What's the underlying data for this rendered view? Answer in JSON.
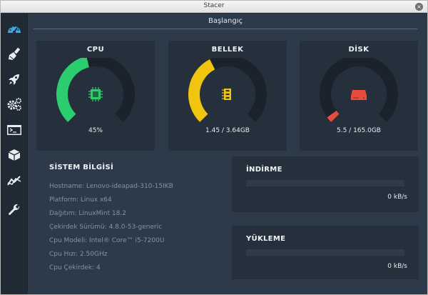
{
  "window": {
    "title": "Stacer",
    "close_glyph": "×"
  },
  "sidebar": {
    "items": [
      {
        "icon": "dashboard-icon",
        "active": true
      },
      {
        "icon": "broom-icon",
        "active": false
      },
      {
        "icon": "rocket-icon",
        "active": false
      },
      {
        "icon": "gears-icon",
        "active": false
      },
      {
        "icon": "terminal-icon",
        "active": false
      },
      {
        "icon": "package-icon",
        "active": false
      },
      {
        "icon": "chart-line-icon",
        "active": false
      },
      {
        "icon": "wrench-icon",
        "active": false
      }
    ]
  },
  "header": {
    "title": "Başlangıç"
  },
  "gauges": {
    "cpu": {
      "title": "CPU",
      "value": "45%",
      "fraction": 0.45,
      "color": "#2bcd6e",
      "icon": "cpu-chip-icon"
    },
    "memory": {
      "title": "BELLEK",
      "value": "1.45 / 3.64GB",
      "fraction": 0.4,
      "color": "#f1c40f",
      "icon": "memory-ram-icon"
    },
    "disk": {
      "title": "DİSK",
      "value": "5.5 / 165.0GB",
      "fraction": 0.033,
      "color": "#e74c3c",
      "icon": "hard-disk-icon"
    }
  },
  "system_info": {
    "title": "SİSTEM BİLGİSİ",
    "lines": [
      "Hostname: Lenovo-ideapad-310-15IKB",
      "Platform: Linux x64",
      "Dağıtım: LinuxMint 18.2",
      "Çekirdek Sürümü: 4.8.0-53-generic",
      "Cpu Modeli: Intel® Core™ i5-7200U",
      "Cpu Hızı: 2.50GHz",
      "Cpu Çekirdek: 4"
    ]
  },
  "network": {
    "download": {
      "title": "İNDİRME",
      "value": "0 kB/s",
      "fraction": 0
    },
    "upload": {
      "title": "YÜKLEME",
      "value": "0 kB/s",
      "fraction": 0
    }
  },
  "colors": {
    "gauge_track": "#1a222b",
    "icon_active": "#3ea8e6",
    "icon_default": "#e8edf1"
  }
}
